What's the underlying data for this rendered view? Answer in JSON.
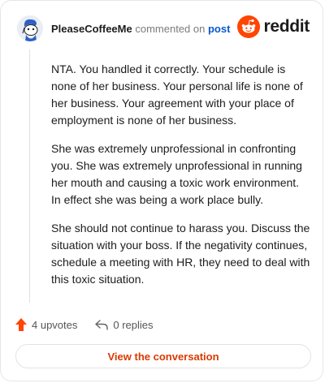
{
  "comment": {
    "author": "PleaseCoffeeMe",
    "verb": "commented on",
    "target": "post",
    "paragraphs": [
      "NTA. You handled it correctly. Your schedule is none of her business. Your personal life is none of her business. Your agreement with your place of employment is none of her business.",
      "She was extremely unprofessional in confronting you. She was extremely unprofessional in running her mouth and causing a toxic work environment. In effect she was being a work place bully.",
      "She should not continue to harass you. Discuss the situation with your boss. If the negativity continues, schedule a meeting with HR, they need to deal with this toxic situation."
    ]
  },
  "brand": {
    "name": "reddit",
    "icon": "reddit-logo-icon",
    "color": "#ff4500"
  },
  "footer": {
    "upvotes": "4 upvotes",
    "replies": "0 replies",
    "upvote_icon": "upvote-arrow-icon",
    "reply_icon": "reply-arrow-icon",
    "upvote_color": "#ff4500"
  },
  "cta": {
    "label": "View the conversation",
    "color": "#d93a00"
  }
}
